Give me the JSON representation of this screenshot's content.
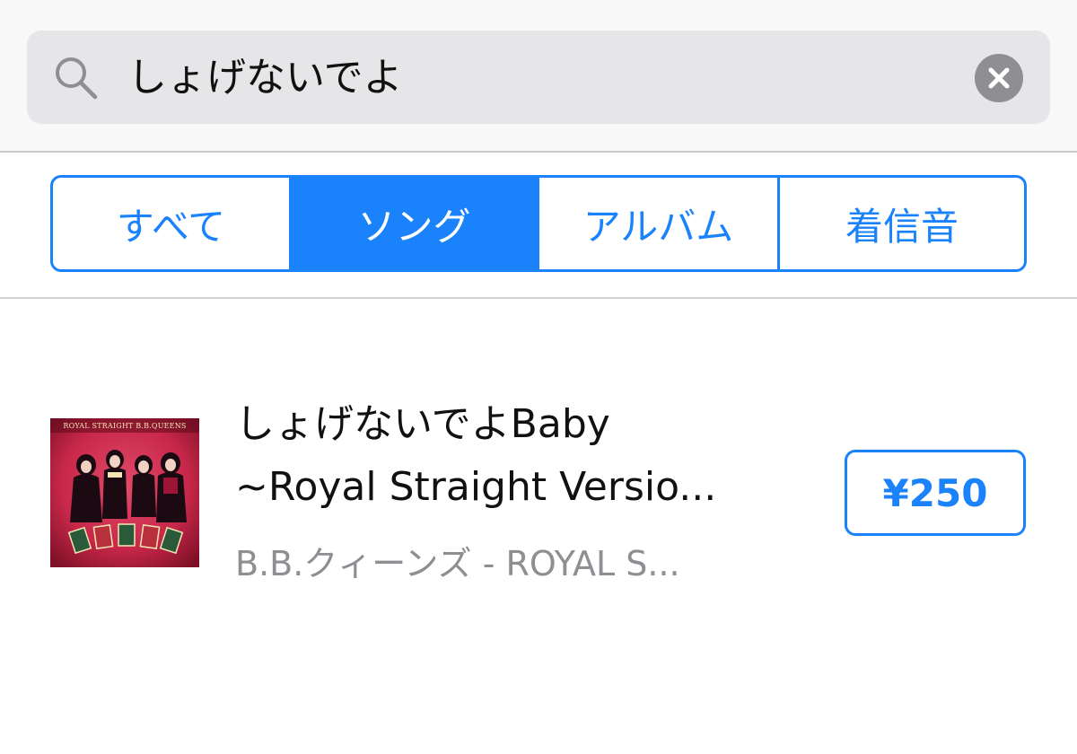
{
  "search": {
    "query": "しょげないでよ",
    "icon": "search-icon",
    "clear_icon": "clear-icon"
  },
  "tabs": [
    {
      "label": "すべて",
      "active": false
    },
    {
      "label": "ソング",
      "active": true
    },
    {
      "label": "アルバム",
      "active": false
    },
    {
      "label": "着信音",
      "active": false
    }
  ],
  "results": [
    {
      "title_line1": "しょげないでよBaby",
      "title_line2": "~Royal Straight Versio...",
      "subtitle": "B.B.クィーンズ - ROYAL S...",
      "price": "¥250",
      "artwork": {
        "banner_text": "ROYAL STRAIGHT B.B.QUEENS",
        "background_color": "#c8284a"
      }
    }
  ],
  "colors": {
    "accent": "#1a82fb",
    "secondary_text": "#8e8e93",
    "search_field": "#e6e6e9"
  }
}
